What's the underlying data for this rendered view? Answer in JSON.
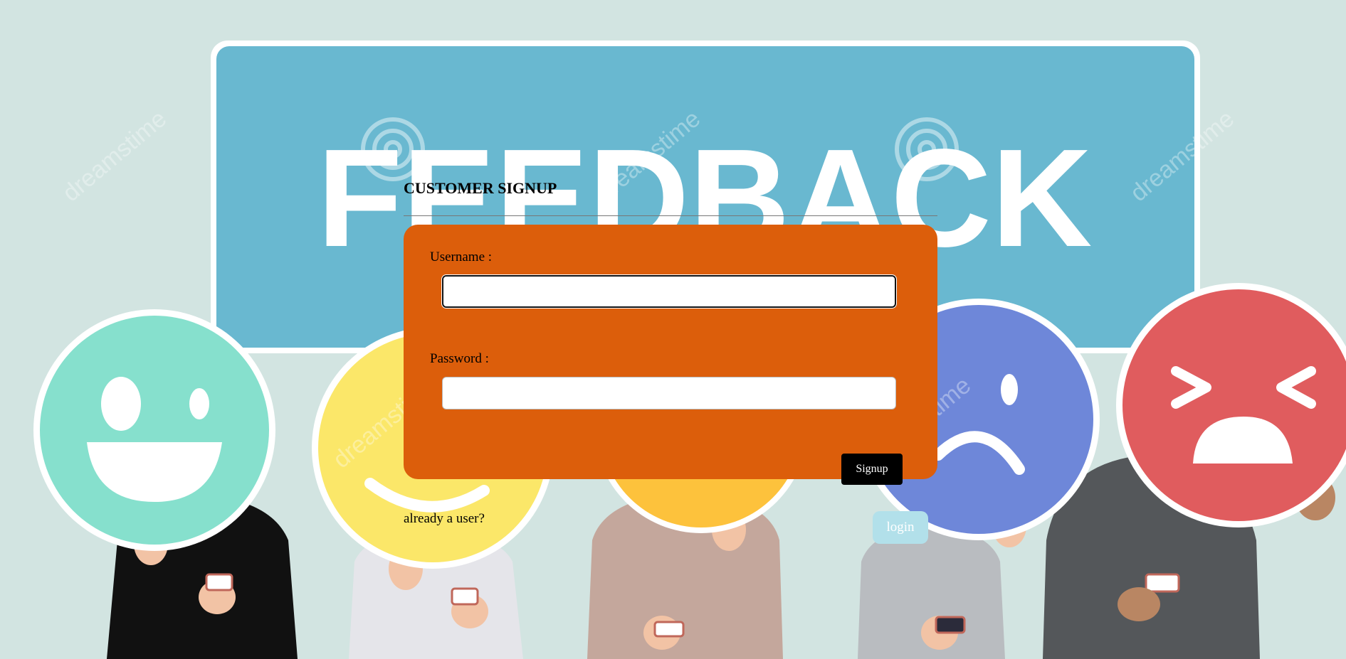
{
  "background": {
    "banner_text": "FEEDBACK",
    "watermark_text": "dreamstime",
    "colors": {
      "page": "#d2e4e1",
      "banner": "#69b8d0",
      "face_green": "#86e0cd",
      "face_yellow": "#fbe769",
      "face_orange": "#fdc23c",
      "face_blue": "#6e87d9",
      "face_red": "#e05c5e"
    }
  },
  "form": {
    "title": "CUSTOMER SIGNUP",
    "username_label": "Username :",
    "username_value": "",
    "password_label": "Password :",
    "password_value": "",
    "signup_label": "Signup",
    "card_color": "#dc5e0b"
  },
  "footer": {
    "already_user_text": "already a user?",
    "login_label": "login"
  }
}
